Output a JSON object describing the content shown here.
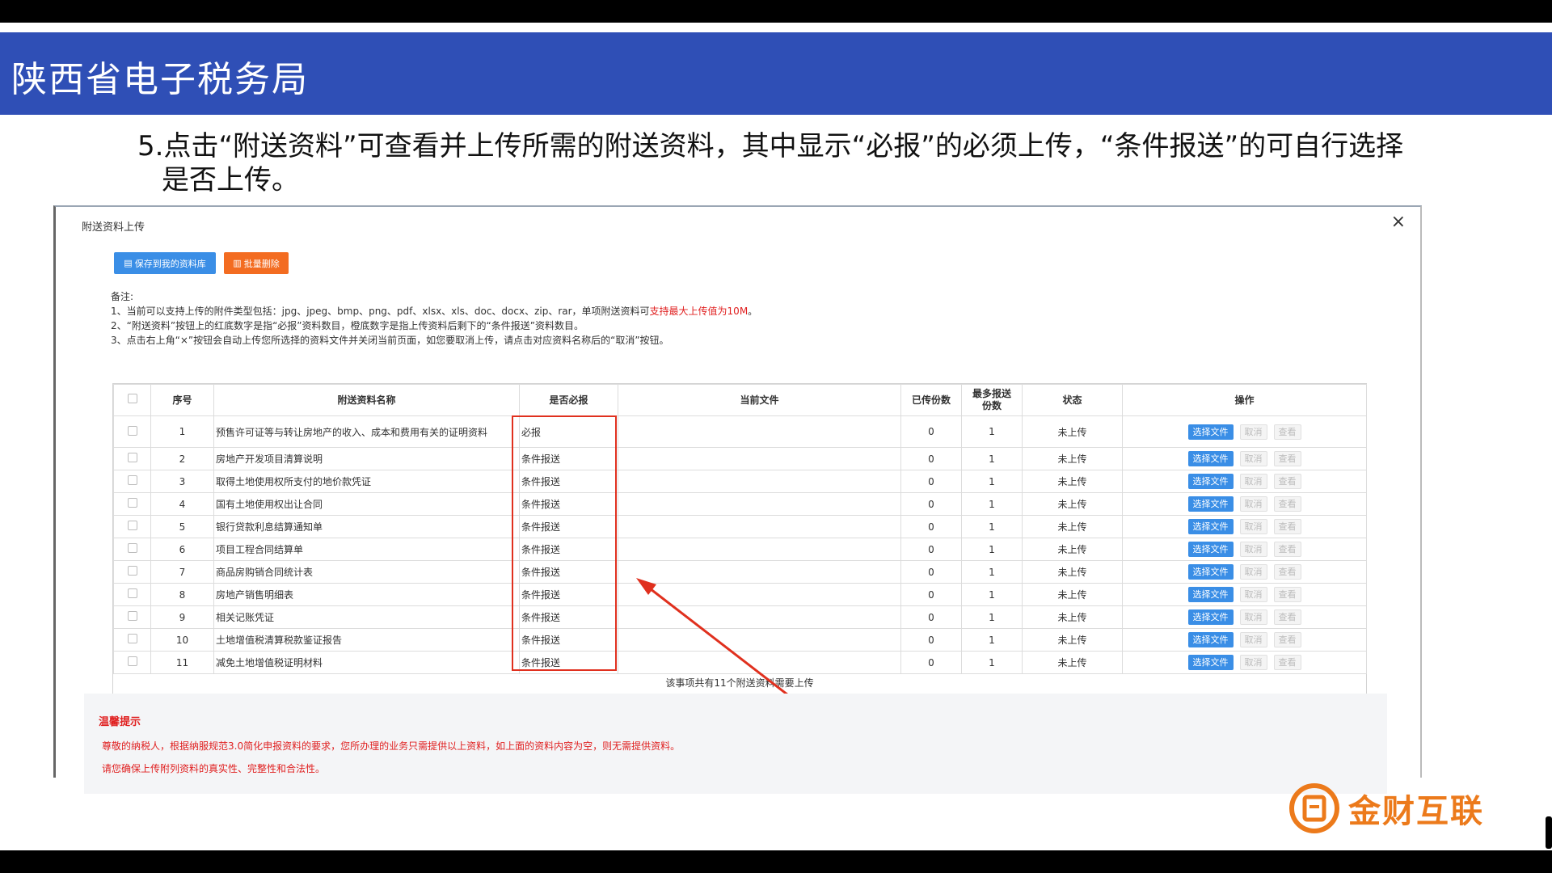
{
  "header": {
    "title": "陕西省电子税务局"
  },
  "instruction": "5.点击“附送资料”可查看并上传所需的附送资料，其中显示“必报”的必须上传，“条件报送”的可自行选择是否上传。",
  "dialog": {
    "title": "附送资料上传",
    "close": "×",
    "save_button": "保存到我的资料库",
    "batch_delete_button": "批量删除",
    "notes": {
      "label": "备注:",
      "line1_prefix": "1、当前可以支持上传的附件类型包括：jpg、jpeg、bmp、png、pdf、xlsx、xls、doc、docx、zip、rar，单项附送资料可",
      "line1_red": "支持最大上传值为10M",
      "line1_suffix": "。",
      "line2": "2、“附送资料”按钮上的红底数字是指“必报”资料数目，橙底数字是指上传资料后剩下的“条件报送”资料数目。",
      "line3": "3、点击右上角“×”按钮会自动上传您所选择的资料文件并关闭当前页面，如您要取消上传，请点击对应资料名称后的“取消”按钮。"
    },
    "table": {
      "headers": [
        "序号",
        "附送资料名称",
        "是否必报",
        "当前文件",
        "已传份数",
        "最多报送份数",
        "状态",
        "操作"
      ],
      "header_max_line1": "最多报送",
      "header_max_line2": "份数",
      "rows": [
        {
          "no": "1",
          "name": "预售许可证等与转让房地产的收入、成本和费用有关的证明资料",
          "req": "必报",
          "file": "",
          "uploaded": "0",
          "max": "1",
          "status": "未上传"
        },
        {
          "no": "2",
          "name": "房地产开发项目清算说明",
          "req": "条件报送",
          "file": "",
          "uploaded": "0",
          "max": "1",
          "status": "未上传"
        },
        {
          "no": "3",
          "name": "取得土地使用权所支付的地价款凭证",
          "req": "条件报送",
          "file": "",
          "uploaded": "0",
          "max": "1",
          "status": "未上传"
        },
        {
          "no": "4",
          "name": "国有土地使用权出让合同",
          "req": "条件报送",
          "file": "",
          "uploaded": "0",
          "max": "1",
          "status": "未上传"
        },
        {
          "no": "5",
          "name": "银行贷款利息结算通知单",
          "req": "条件报送",
          "file": "",
          "uploaded": "0",
          "max": "1",
          "status": "未上传"
        },
        {
          "no": "6",
          "name": "项目工程合同结算单",
          "req": "条件报送",
          "file": "",
          "uploaded": "0",
          "max": "1",
          "status": "未上传"
        },
        {
          "no": "7",
          "name": "商品房购销合同统计表",
          "req": "条件报送",
          "file": "",
          "uploaded": "0",
          "max": "1",
          "status": "未上传"
        },
        {
          "no": "8",
          "name": "房地产销售明细表",
          "req": "条件报送",
          "file": "",
          "uploaded": "0",
          "max": "1",
          "status": "未上传"
        },
        {
          "no": "9",
          "name": "相关记账凭证",
          "req": "条件报送",
          "file": "",
          "uploaded": "0",
          "max": "1",
          "status": "未上传"
        },
        {
          "no": "10",
          "name": "土地增值税清算税款鉴证报告",
          "req": "条件报送",
          "file": "",
          "uploaded": "0",
          "max": "1",
          "status": "未上传"
        },
        {
          "no": "11",
          "name": "减免土地增值税证明材料",
          "req": "条件报送",
          "file": "",
          "uploaded": "0",
          "max": "1",
          "status": "未上传"
        }
      ],
      "op_select": "选择文件",
      "op_cancel": "取消",
      "op_view": "查看",
      "summary": "该事项共有11个附送资料需要上传"
    }
  },
  "tips": {
    "title": "温馨提示",
    "line1": "尊敬的纳税人，根据纳服规范3.0简化申报资料的要求，您所办理的业务只需提供以上资料，如上面的资料内容为空，则无需提供资料。",
    "line2": "请您确保上传附列资料的真实性、完整性和合法性。"
  },
  "brand": {
    "text": "金财互联"
  },
  "colors": {
    "header_blue": "#2f4fb6",
    "button_blue": "#3a8ee6",
    "button_orange": "#f36c21",
    "highlight_red": "#e0301e",
    "brand_orange": "#ec7a1b"
  }
}
